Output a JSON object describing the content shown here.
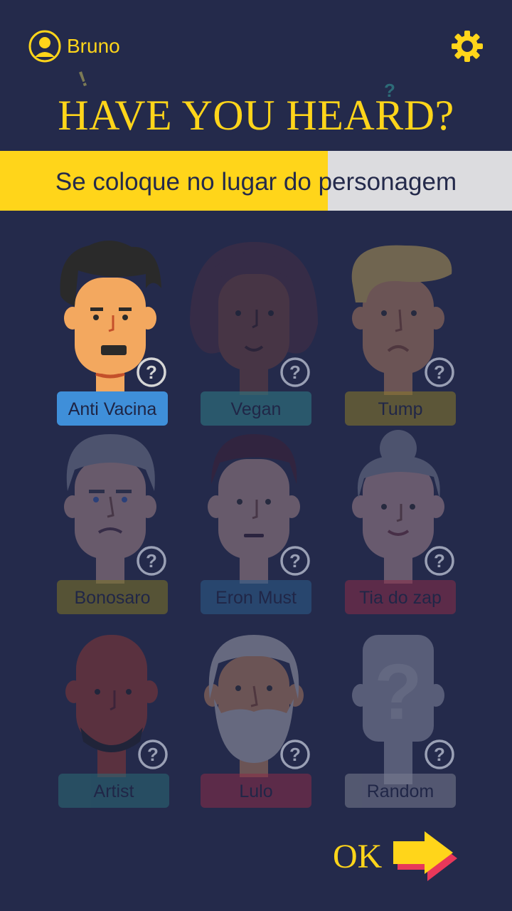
{
  "user": {
    "name": "Bruno"
  },
  "title": "HAVE YOU HEARD?",
  "subtitle": "Se coloque no lugar do personagem",
  "progress": 0.64,
  "colors": {
    "accent": "#ffd51a",
    "background": "#242a4b"
  },
  "characters": [
    {
      "label": "Anti Vacina",
      "color": "#3f8fd9",
      "selected": true
    },
    {
      "label": "Vegan",
      "color": "#2f7f88",
      "selected": false
    },
    {
      "label": "Tump",
      "color": "#8a7a2a",
      "selected": false
    },
    {
      "label": "Bonosaro",
      "color": "#7f7626",
      "selected": false
    },
    {
      "label": "Eron Must",
      "color": "#2c5d8c",
      "selected": false
    },
    {
      "label": "Tia do zap",
      "color": "#8b2d48",
      "selected": false
    },
    {
      "label": "Artist",
      "color": "#2b6b76",
      "selected": false
    },
    {
      "label": "Lulo",
      "color": "#8b2d48",
      "selected": false
    },
    {
      "label": "Random",
      "color": "#7a7d90",
      "selected": false
    }
  ],
  "ok_label": "OK",
  "icons": {
    "user": "user-avatar-icon",
    "settings": "gear-icon",
    "help": "question-icon",
    "next": "arrow-right-icon"
  }
}
